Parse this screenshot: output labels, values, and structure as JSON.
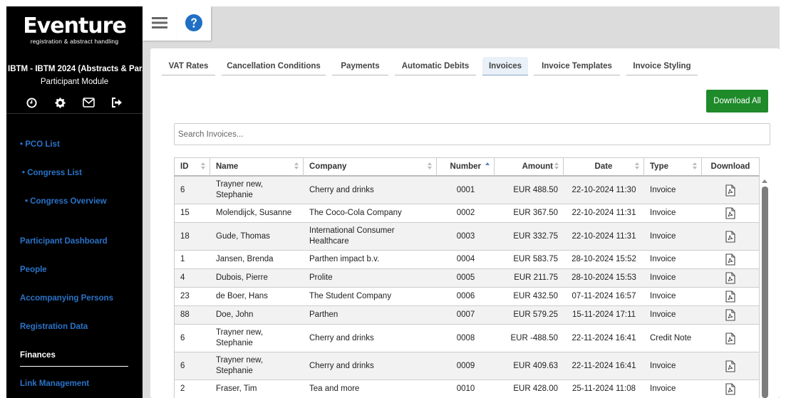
{
  "sidebar": {
    "logo": "Eventure",
    "logo_sub": "registration & abstract handling",
    "event_title": "IBTM - IBTM 2024 (Abstracts & Par...",
    "module": "Participant Module",
    "icons": [
      "clock-icon",
      "gear-icon",
      "mail-icon",
      "logout-icon"
    ],
    "items": [
      {
        "label": "• PCO List"
      },
      {
        "label": "• Congress List"
      },
      {
        "label": "• Congress Overview"
      },
      {
        "label": "Participant Dashboard"
      },
      {
        "label": "People"
      },
      {
        "label": "Accompanying Persons"
      },
      {
        "label": "Registration Data"
      },
      {
        "label": "Finances"
      },
      {
        "label": "Link Management"
      }
    ],
    "active_item": "Finances"
  },
  "toolbar": {
    "menu_icon": "hamburger-menu-icon",
    "help_icon": "help-circle-icon"
  },
  "tabs": [
    {
      "label": "VAT Rates"
    },
    {
      "label": "Cancellation Conditions"
    },
    {
      "label": "Payments"
    },
    {
      "label": "Automatic Debits"
    },
    {
      "label": "Invoices"
    },
    {
      "label": "Invoice Templates"
    },
    {
      "label": "Invoice Styling"
    }
  ],
  "active_tab": "Invoices",
  "download_all_label": "Download All",
  "search": {
    "placeholder": "Search Invoices..."
  },
  "table": {
    "headers": {
      "id": "ID",
      "name": "Name",
      "company": "Company",
      "number": "Number",
      "amount": "Amount",
      "date": "Date",
      "type": "Type",
      "download": "Download"
    },
    "sorted_column": "Number",
    "rows": [
      {
        "id": "6",
        "name": "Trayner new, Stephanie",
        "company": "Cherry and drinks",
        "number": "0001",
        "amount": "EUR 488.50",
        "date": "22-10-2024 11:30",
        "type": "Invoice"
      },
      {
        "id": "15",
        "name": "Molendijck, Susanne",
        "company": "The Coco-Cola Company",
        "number": "0002",
        "amount": "EUR 367.50",
        "date": "22-10-2024 11:31",
        "type": "Invoice"
      },
      {
        "id": "18",
        "name": "Gude, Thomas",
        "company": "International Consumer Healthcare",
        "number": "0003",
        "amount": "EUR 332.75",
        "date": "22-10-2024 11:31",
        "type": "Invoice"
      },
      {
        "id": "1",
        "name": "Jansen, Brenda",
        "company": "Parthen impact b.v.",
        "number": "0004",
        "amount": "EUR 583.75",
        "date": "28-10-2024 15:52",
        "type": "Invoice"
      },
      {
        "id": "4",
        "name": "Dubois, Pierre",
        "company": "Prolite",
        "number": "0005",
        "amount": "EUR 211.75",
        "date": "28-10-2024 15:53",
        "type": "Invoice"
      },
      {
        "id": "23",
        "name": "de Boer, Hans",
        "company": "The Student Company",
        "number": "0006",
        "amount": "EUR 432.50",
        "date": "07-11-2024 16:57",
        "type": "Invoice"
      },
      {
        "id": "88",
        "name": "Doe, John",
        "company": "Parthen",
        "number": "0007",
        "amount": "EUR 579.25",
        "date": "15-11-2024 17:11",
        "type": "Invoice"
      },
      {
        "id": "6",
        "name": "Trayner new, Stephanie",
        "company": "Cherry and drinks",
        "number": "0008",
        "amount": "EUR -488.50",
        "date": "22-11-2024 16:41",
        "type": "Credit Note"
      },
      {
        "id": "6",
        "name": "Trayner new, Stephanie",
        "company": "Cherry and drinks",
        "number": "0009",
        "amount": "EUR 409.63",
        "date": "22-11-2024 16:41",
        "type": "Invoice"
      },
      {
        "id": "2",
        "name": "Fraser, Tim",
        "company": "Tea and more",
        "number": "0010",
        "amount": "EUR 428.00",
        "date": "25-11-2024 11:08",
        "type": "Invoice"
      }
    ]
  },
  "colors": {
    "sidebar_bg": "#000000",
    "link_blue": "#2a73c8",
    "download_green": "#1e8a2a",
    "help_blue": "#1f6fc4"
  }
}
